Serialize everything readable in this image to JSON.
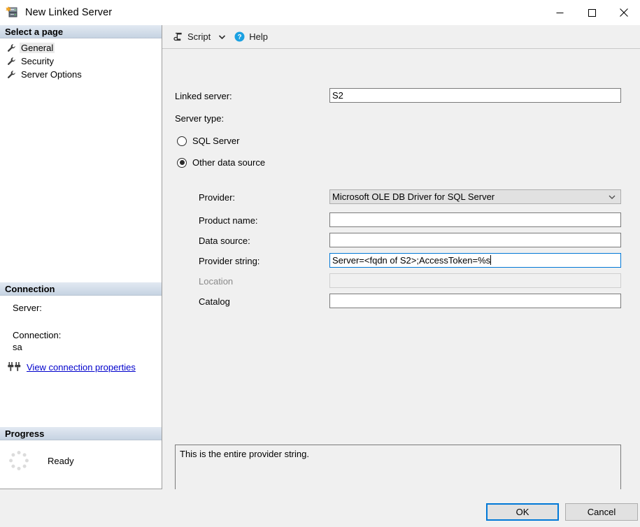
{
  "window": {
    "title": "New Linked Server",
    "icon": "new-linked-server-icon",
    "minimize_label": "—",
    "maximize_label": "□",
    "close_label": "✕"
  },
  "sidebar": {
    "select_page_header": "Select a page",
    "pages": [
      {
        "label": "General",
        "icon": "wrench-icon",
        "selected": true
      },
      {
        "label": "Security",
        "icon": "wrench-icon",
        "selected": false
      },
      {
        "label": "Server Options",
        "icon": "wrench-icon",
        "selected": false
      }
    ],
    "connection": {
      "header": "Connection",
      "server_label": "Server:",
      "server_value": "",
      "connection_label": "Connection:",
      "connection_value": "sa",
      "link_icon": "connection-plug-icon",
      "link_label": "View connection properties"
    },
    "progress": {
      "header": "Progress",
      "spinner_icon": "progress-spinner-icon",
      "status": "Ready"
    }
  },
  "toolbar": {
    "script_icon": "script-icon",
    "script_label": "Script",
    "script_caret_icon": "chevron-down-icon",
    "help_icon": "help-question-icon",
    "help_label": "Help"
  },
  "form": {
    "linked_server": {
      "label": "Linked server:",
      "value": "S2",
      "placeholder": ""
    },
    "server_type": {
      "label": "Server type:",
      "options": [
        {
          "label": "SQL Server",
          "selected": false
        },
        {
          "label": "Other data source",
          "selected": true
        }
      ]
    },
    "provider": {
      "label": "Provider:",
      "value": "Microsoft OLE DB Driver for SQL Server",
      "chevron_icon": "chevron-down-icon"
    },
    "product_name": {
      "label": "Product name:",
      "value": "",
      "placeholder": ""
    },
    "data_source": {
      "label": "Data source:",
      "value": "",
      "placeholder": ""
    },
    "provider_string": {
      "label": "Provider string:",
      "value": "Server=<fqdn of S2>;AccessToken=%s",
      "placeholder": "",
      "focused": true
    },
    "location": {
      "label": "Location",
      "value": "",
      "placeholder": "",
      "disabled": true
    },
    "catalog": {
      "label": "Catalog",
      "value": "",
      "placeholder": ""
    }
  },
  "description": {
    "text": "This is the entire provider string."
  },
  "footer": {
    "ok_label": "OK",
    "cancel_label": "Cancel"
  },
  "colors": {
    "accent": "#0078d7",
    "link": "#0000cc",
    "dialog_bg": "#f0f0f0",
    "panel_header_top": "#e2e9f2",
    "panel_header_bottom": "#c6d3e2"
  }
}
